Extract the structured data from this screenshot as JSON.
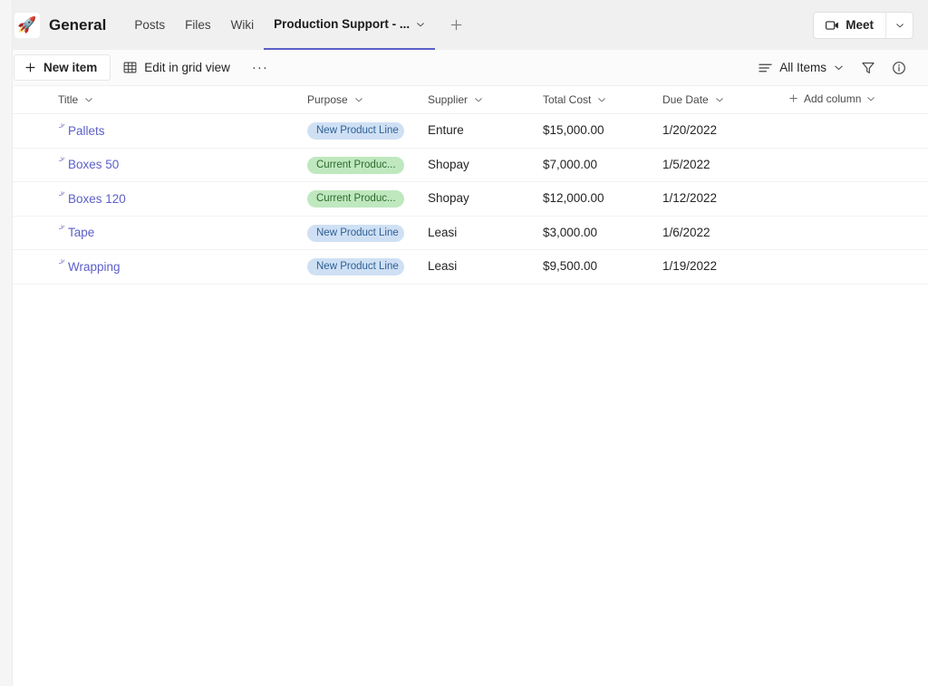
{
  "channel": {
    "icon": "rocket-icon",
    "icon_glyph": "🚀",
    "title": "General",
    "tabs": [
      {
        "label": "Posts",
        "active": false
      },
      {
        "label": "Files",
        "active": false
      },
      {
        "label": "Wiki",
        "active": false
      },
      {
        "label": "Production Support - ...",
        "active": true
      }
    ],
    "add_tab_label": "+",
    "meet": {
      "label": "Meet",
      "icon": "video-camera-icon",
      "dropdown_icon": "chevron-down-icon"
    }
  },
  "toolbar": {
    "new_item_label": "New item",
    "new_item_icon": "plus-icon",
    "edit_grid_label": "Edit in grid view",
    "edit_grid_icon": "grid-icon",
    "more_label": "···",
    "view_label": "All Items",
    "view_icon": "list-icon",
    "view_chevron": "chevron-down-icon",
    "filter_icon": "filter-icon",
    "info_icon": "info-icon"
  },
  "list": {
    "columns": [
      {
        "label": "Title",
        "sort_icon": "chevron-down-icon"
      },
      {
        "label": "Purpose",
        "sort_icon": "chevron-down-icon"
      },
      {
        "label": "Supplier",
        "sort_icon": "chevron-down-icon"
      },
      {
        "label": "Total Cost",
        "sort_icon": "chevron-down-icon"
      },
      {
        "label": "Due Date",
        "sort_icon": "chevron-down-icon"
      }
    ],
    "add_column_label": "Add column",
    "add_column_icon": "plus-icon",
    "rows": [
      {
        "title": "Pallets",
        "purpose": "New Product Line",
        "purpose_color": "blue",
        "supplier": "Enture",
        "total_cost": "$15,000.00",
        "due_date": "1/20/2022"
      },
      {
        "title": "Boxes 50",
        "purpose": "Current Produc...",
        "purpose_color": "green",
        "supplier": "Shopay",
        "total_cost": "$7,000.00",
        "due_date": "1/5/2022"
      },
      {
        "title": "Boxes 120",
        "purpose": "Current Produc...",
        "purpose_color": "green",
        "supplier": "Shopay",
        "total_cost": "$12,000.00",
        "due_date": "1/12/2022"
      },
      {
        "title": "Tape",
        "purpose": "New Product Line",
        "purpose_color": "blue",
        "supplier": "Leasi",
        "total_cost": "$3,000.00",
        "due_date": "1/6/2022"
      },
      {
        "title": "Wrapping",
        "purpose": "New Product Line",
        "purpose_color": "blue",
        "supplier": "Leasi",
        "total_cost": "$9,500.00",
        "due_date": "1/19/2022"
      }
    ]
  },
  "colors": {
    "accent": "#5b5fc7",
    "header_bg": "#f0f0f0",
    "pill_blue_bg": "#cfe0f4",
    "pill_blue_text": "#2e5f94",
    "pill_green_bg": "#bfe8bf",
    "pill_green_text": "#2d6a2d"
  }
}
